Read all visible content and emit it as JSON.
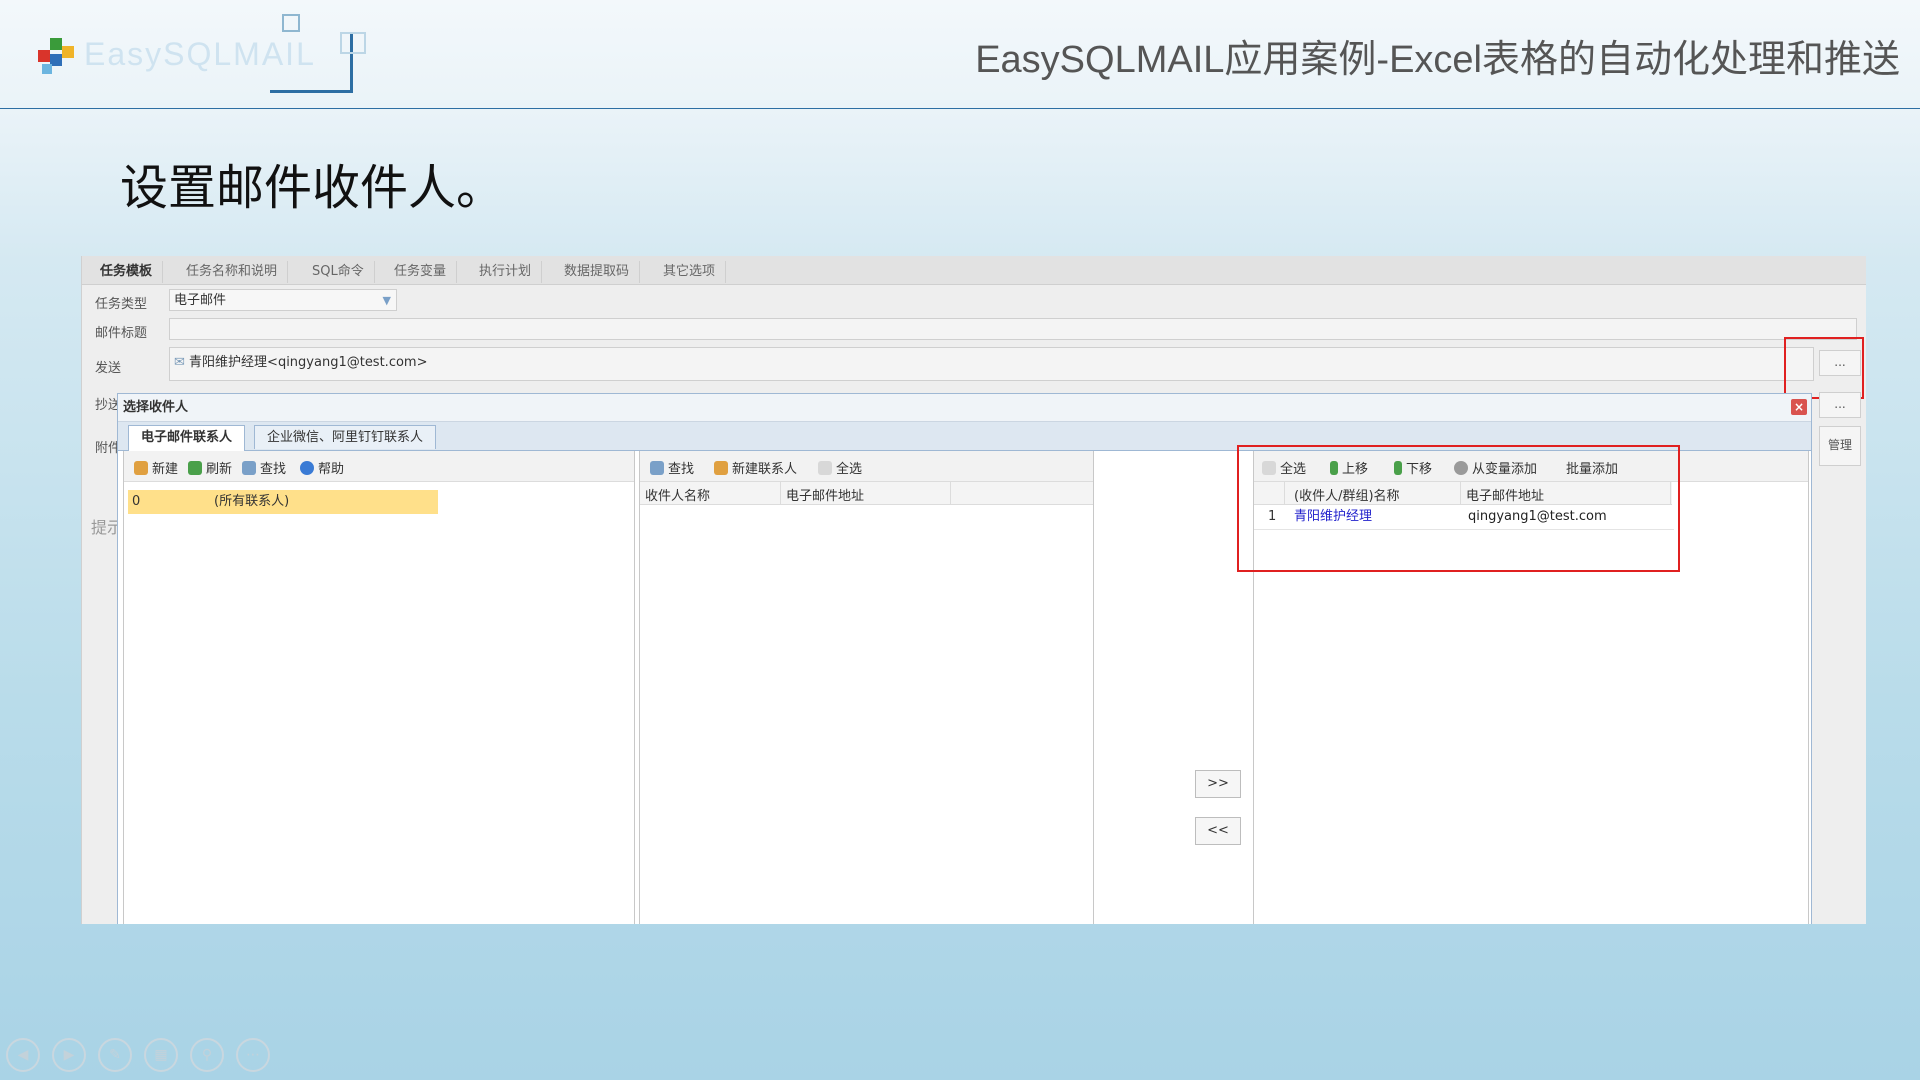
{
  "slide": {
    "logo_text": "EasySQLMAIL",
    "title": "EasySQLMAIL应用案例-Excel表格的自动化处理和推送",
    "heading": "设置邮件收件人。"
  },
  "app": {
    "tabs": [
      "任务模板",
      "任务名称和说明",
      "SQL命令",
      "任务变量",
      "执行计划",
      "数据提取码",
      "其它选项"
    ],
    "labels": {
      "task_type": "任务类型",
      "mail_subject": "邮件标题",
      "send": "发送",
      "cc": "抄送",
      "attach": "附件",
      "hint": "提示"
    },
    "task_type_value": "电子邮件",
    "send_value": "青阳维护经理<qingyang1@test.com>",
    "ellipsis": "...",
    "manage_label": "管理"
  },
  "dialog": {
    "title": "选择收件人",
    "close": "×",
    "tabs": [
      "电子邮件联系人",
      "企业微信、阿里钉钉联系人"
    ],
    "left_toolbar": [
      "新建",
      "刷新",
      "查找",
      "帮助"
    ],
    "group_row": {
      "id": "0",
      "name": "(所有联系人)"
    },
    "middle_toolbar": [
      "查找",
      "新建联系人",
      "全选"
    ],
    "middle_columns": [
      "收件人名称",
      "电子邮件地址"
    ],
    "add_button": ">>",
    "remove_button": "<<",
    "right_toolbar": [
      "全选",
      "上移",
      "下移",
      "从变量添加",
      "批量添加"
    ],
    "right_columns": [
      "(收件人/群组)名称",
      "电子邮件地址"
    ],
    "recipients": [
      {
        "index": "1",
        "name": "青阳维护经理",
        "email": "qingyang1@test.com"
      }
    ]
  },
  "colors": {
    "highlight_red": "#e02020",
    "selected_row": "#ffe08a",
    "header_rule": "#2d6ea3",
    "link_blue": "#2222cc"
  }
}
